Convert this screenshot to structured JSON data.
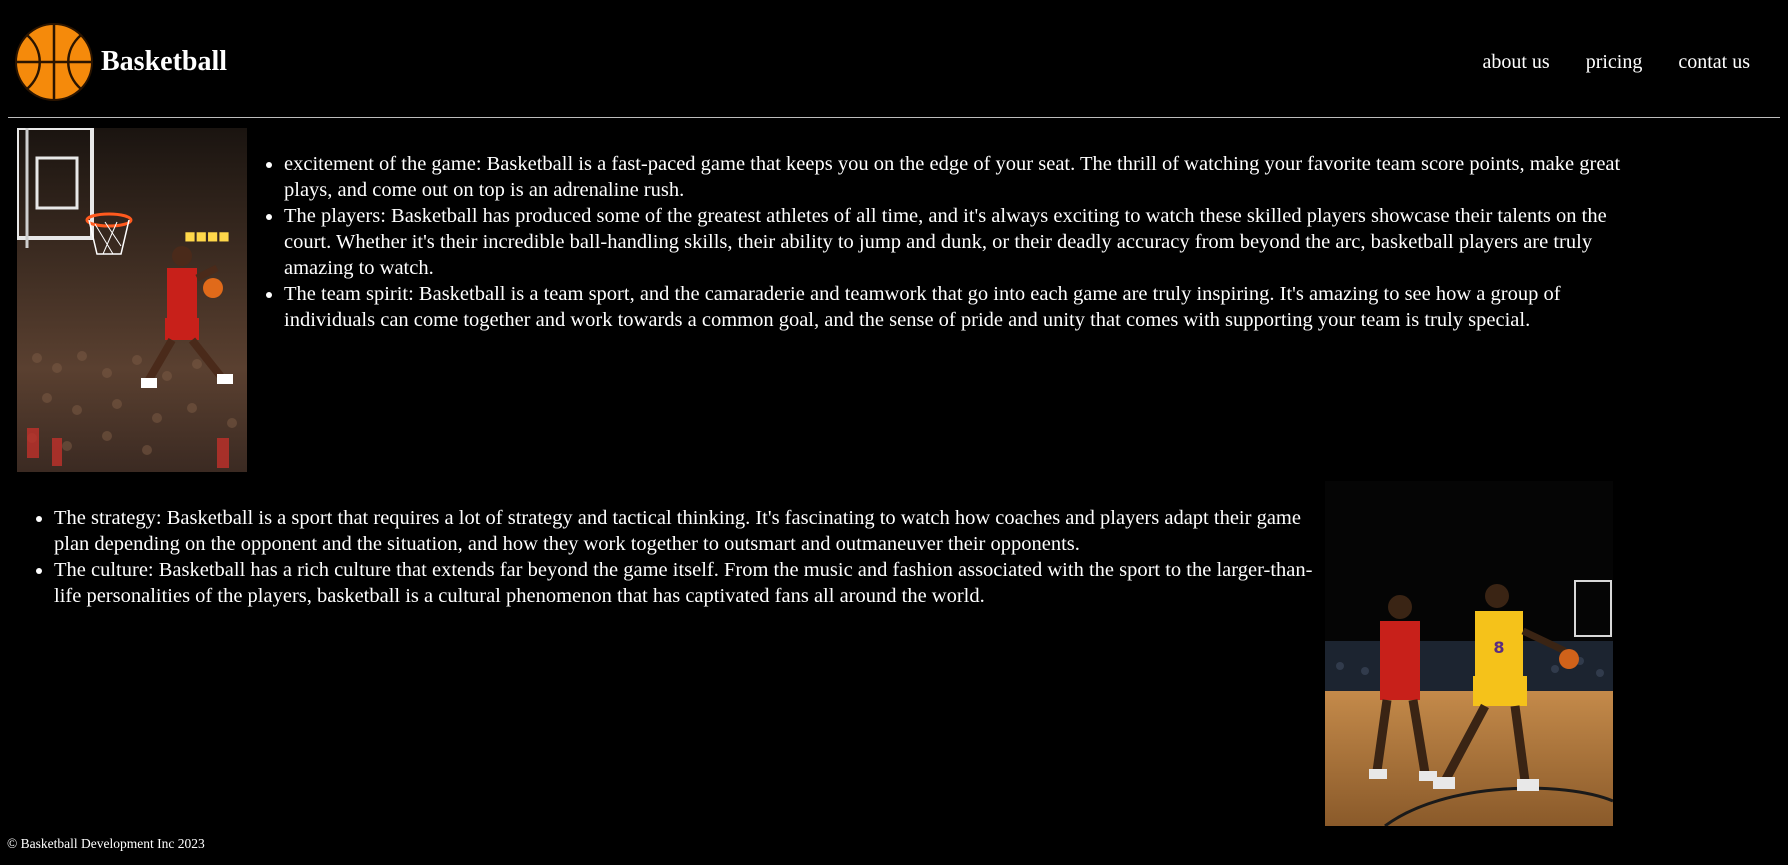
{
  "header": {
    "brand": "Basketball",
    "logo_icon": "basketball-icon",
    "nav": [
      {
        "label": "about us"
      },
      {
        "label": "pricing"
      },
      {
        "label": "contat us"
      }
    ]
  },
  "section1": {
    "image_description_icon": "slam-dunk-photo",
    "items": [
      "excitement of the game: Basketball is a fast-paced game that keeps you on the edge of your seat. The thrill of watching your favorite team score points, make great plays, and come out on top is an adrenaline rush.",
      "The players: Basketball has produced some of the greatest athletes of all time, and it's always exciting to watch these skilled players showcase their talents on the court. Whether it's their incredible ball-handling skills, their ability to jump and dunk, or their deadly accuracy from beyond the arc, basketball players are truly amazing to watch.",
      "The team spirit: Basketball is a team sport, and the camaraderie and teamwork that go into each game are truly inspiring. It's amazing to see how a group of individuals can come together and work towards a common goal, and the sense of pride and unity that comes with supporting your team is truly special."
    ]
  },
  "section2": {
    "image_description_icon": "one-on-one-photo",
    "items": [
      "The strategy: Basketball is a sport that requires a lot of strategy and tactical thinking. It's fascinating to watch how coaches and players adapt their game plan depending on the opponent and the situation, and how they work together to outsmart and outmaneuver their opponents.",
      "The culture: Basketball has a rich culture that extends far beyond the game itself. From the music and fashion associated with the sport to the larger-than-life personalities of the players, basketball is a cultural phenomenon that has captivated fans all around the world."
    ]
  },
  "footer": {
    "copyright": "© Basketball Development Inc 2023"
  },
  "colors": {
    "background": "#000000",
    "text": "#ffffff",
    "ball": "#f58a0b"
  }
}
